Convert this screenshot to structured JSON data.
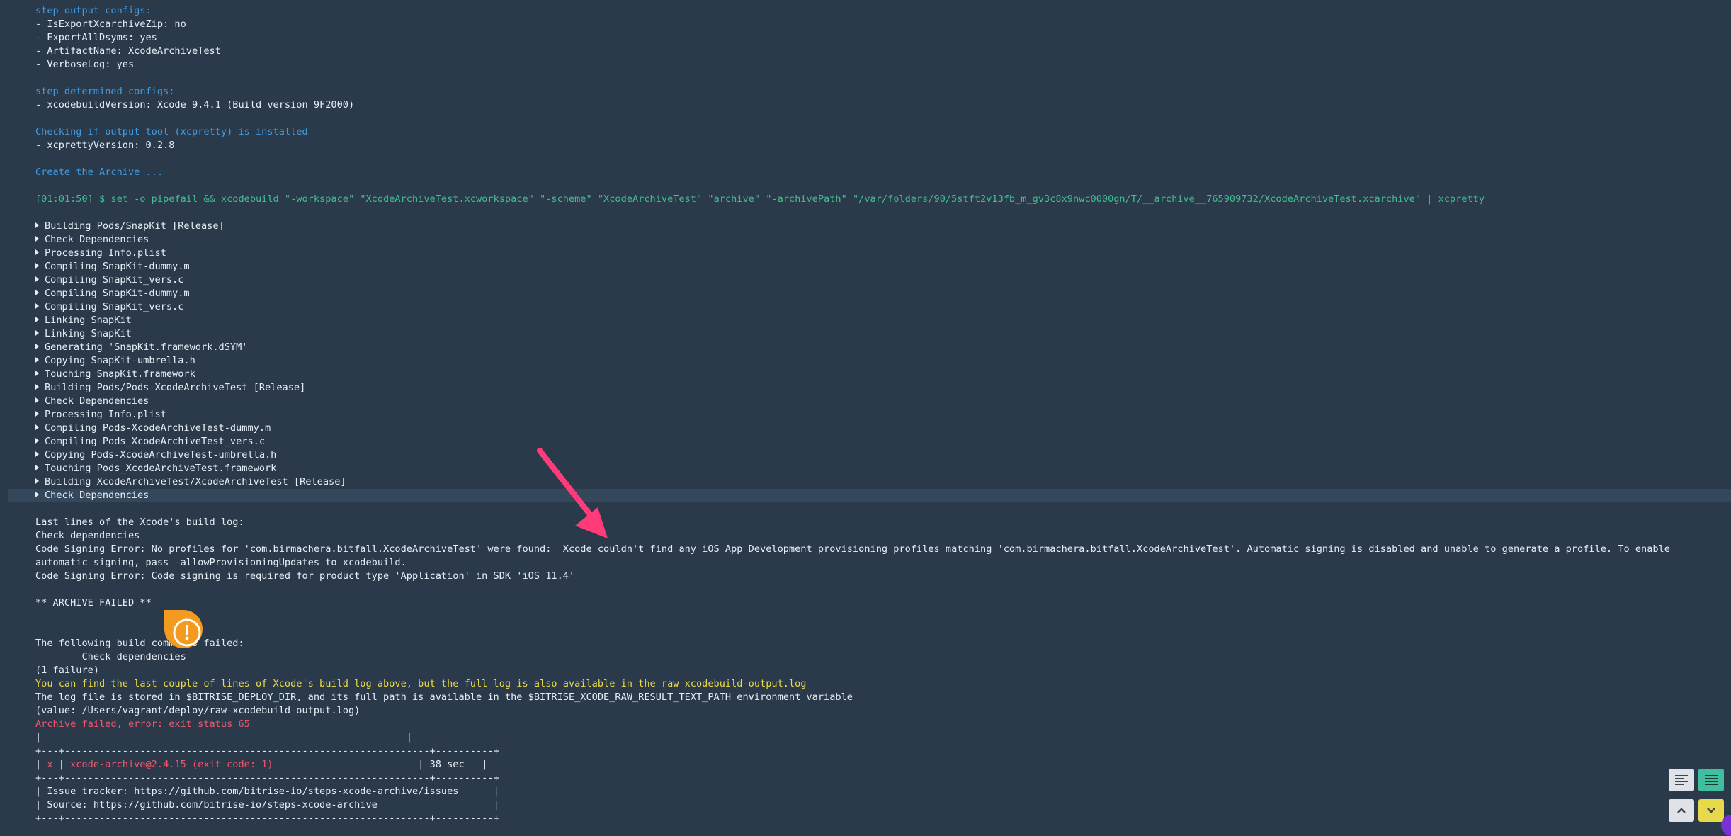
{
  "colors": {
    "background": "#2b3a4b",
    "section_heading": "#3f9ce0",
    "command": "#3fbf8f",
    "warning_text": "#e8d94a",
    "error_text": "#f2556d",
    "annotation_arrow": "#ff3b7a",
    "warning_marker": "#f29b1f"
  },
  "output_configs": {
    "heading": "step output configs:",
    "items": [
      "- IsExportXcarchiveZip: no",
      "- ExportAllDsyms: yes",
      "- ArtifactName: XcodeArchiveTest",
      "- VerboseLog: yes"
    ]
  },
  "determined_configs": {
    "heading": "step determined configs:",
    "items": [
      "- xcodebuildVersion: Xcode 9.4.1 (Build version 9F2000)"
    ]
  },
  "checking_tool": {
    "heading": "Checking if output tool (xcpretty) is installed",
    "items": [
      "- xcprettyVersion: 0.2.8"
    ]
  },
  "create_archive": {
    "heading": "Create the Archive ..."
  },
  "command_line": "[01:01:50] $ set -o pipefail && xcodebuild \"-workspace\" \"XcodeArchiveTest.xcworkspace\" \"-scheme\" \"XcodeArchiveTest\" \"archive\" \"-archivePath\" \"/var/folders/90/5stft2v13fb_m_gv3c8x9nwc0000gn/T/__archive__765909732/XcodeArchiveTest.xcarchive\" | xcpretty",
  "build_steps": [
    "Building Pods/SnapKit [Release]",
    "Check Dependencies",
    "Processing Info.plist",
    "Compiling SnapKit-dummy.m",
    "Compiling SnapKit_vers.c",
    "Compiling SnapKit-dummy.m",
    "Compiling SnapKit_vers.c",
    "Linking SnapKit",
    "Linking SnapKit",
    "Generating 'SnapKit.framework.dSYM'",
    "Copying SnapKit-umbrella.h",
    "Touching SnapKit.framework",
    "Building Pods/Pods-XcodeArchiveTest [Release]",
    "Check Dependencies",
    "Processing Info.plist",
    "Compiling Pods-XcodeArchiveTest-dummy.m",
    "Compiling Pods_XcodeArchiveTest_vers.c",
    "Copying Pods-XcodeArchiveTest-umbrella.h",
    "Touching Pods_XcodeArchiveTest.framework",
    "Building XcodeArchiveTest/XcodeArchiveTest [Release]",
    "Check Dependencies"
  ],
  "build_log": {
    "lines": [
      "Last lines of the Xcode's build log:",
      "Check dependencies",
      "Code Signing Error: No profiles for 'com.birmachera.bitfall.XcodeArchiveTest' were found:  Xcode couldn't find any iOS App Development provisioning profiles matching 'com.birmachera.bitfall.XcodeArchiveTest'. Automatic signing is disabled and unable to generate a profile. To enable",
      "automatic signing, pass -allowProvisioningUpdates to xcodebuild.",
      "Code Signing Error: Code signing is required for product type 'Application' in SDK 'iOS 11.4'"
    ],
    "archive_failed": "** ARCHIVE FAILED **",
    "following_failed": "The following build commands failed:",
    "failed_command": "        Check dependencies",
    "failure_count": "(1 failure)"
  },
  "notices": {
    "full_log_notice": "You can find the last couple of lines of Xcode's build log above, but the full log is also available in the raw-xcodebuild-output.log",
    "log_stored": "The log file is stored in $BITRISE_DEPLOY_DIR, and its full path is available in the $BITRISE_XCODE_RAW_RESULT_TEXT_PATH environment variable",
    "log_value": "(value: /Users/vagrant/deploy/raw-xcodebuild-output.log)",
    "error": "Archive failed, error: exit status 65"
  },
  "summary_box": {
    "blank_row": "|                                                               |",
    "border": "+---+---------------------------------------------------------------+----------+",
    "row_prefix": "| ",
    "status_mark": "x",
    "row_mid": " | ",
    "step_title": "xcode-archive@2.4.15 (exit code: 1)",
    "row_pad": "                         | ",
    "duration": "38 sec",
    "row_suffix": "   |",
    "issue_line": "| Issue tracker: https://github.com/bitrise-io/steps-xcode-archive/issues      |",
    "source_line": "| Source: https://github.com/bitrise-io/steps-xcode-archive                    |"
  },
  "controls": {
    "wrap_icon": "text-align-left-icon",
    "lines_icon": "text-lines-icon",
    "up_icon": "chevron-up-icon",
    "down_icon": "chevron-down-icon"
  }
}
